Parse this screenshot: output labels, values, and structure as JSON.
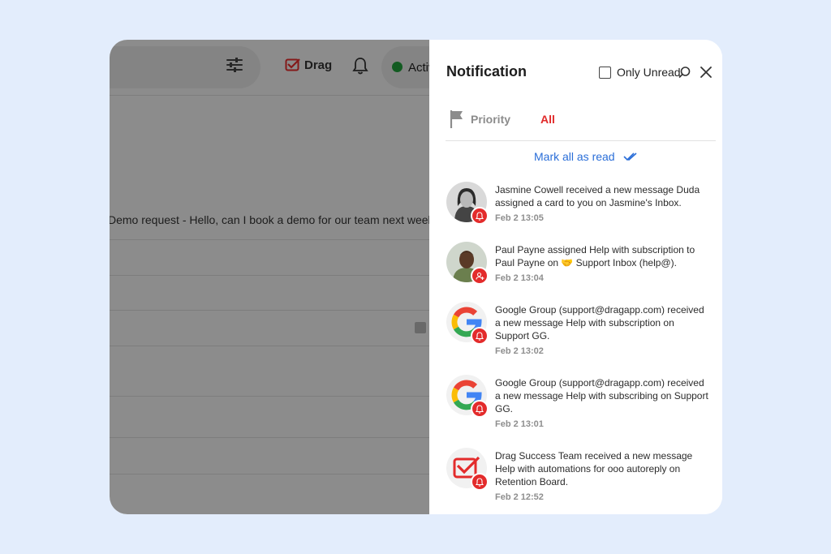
{
  "app": {
    "brand_label": "Drag",
    "status_label": "Active",
    "demo_text": "Demo request - Hello, can I book a demo for our team next week?"
  },
  "panel": {
    "title": "Notification",
    "only_unread_label": "Only Unread",
    "tabs": [
      {
        "label": "Priority",
        "icon": "flag-icon",
        "active": false
      },
      {
        "label": "All",
        "active": true
      }
    ],
    "mark_all_label": "Mark all as read",
    "accent_color": "#e12a2a",
    "link_color": "#2a6ed8"
  },
  "notifications": [
    {
      "avatar": "jasmine-avatar",
      "text": "Jasmine Cowell received a new message Duda assigned a card to you on Jasmine's Inbox.",
      "time": "Feb 2 13:05",
      "badge_icon": "bell-icon"
    },
    {
      "avatar": "paul-avatar",
      "text": "Paul Payne assigned Help with subscription to Paul Payne on 🤝 Support Inbox (help@).",
      "time": "Feb 2 13:04",
      "badge_icon": "user-plus-icon"
    },
    {
      "avatar": "google-logo",
      "text": "Google Group (support@dragapp.com) received a new message Help with subscription on Support GG.",
      "time": "Feb 2 13:02",
      "badge_icon": "bell-icon"
    },
    {
      "avatar": "google-logo",
      "text": "Google Group (support@dragapp.com) received a new message Help with subscribing on Support GG.",
      "time": "Feb 2 13:01",
      "badge_icon": "bell-icon"
    },
    {
      "avatar": "drag-logo",
      "text": "Drag Success Team received a new message Help with automations for ooo autoreply on Retention Board.",
      "time": "Feb 2 12:52",
      "badge_icon": "bell-icon"
    }
  ]
}
